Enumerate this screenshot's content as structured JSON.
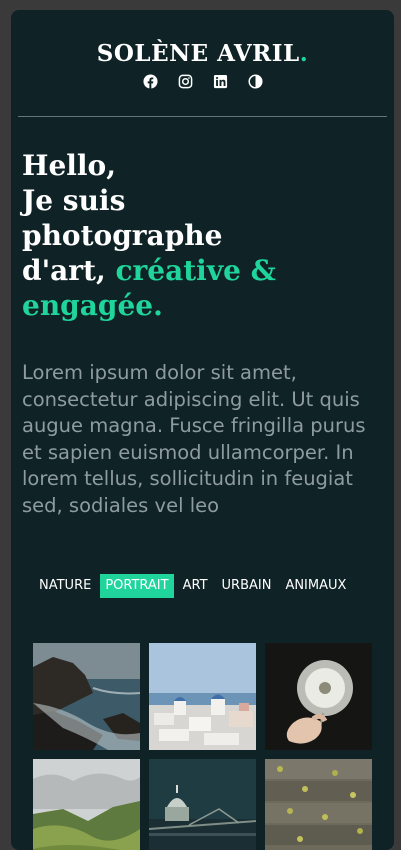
{
  "header": {
    "brand_name": "SOLÈNE AVRIL",
    "brand_dot": ".",
    "accent_color": "#1fd59b",
    "social_icons": [
      "facebook-icon",
      "instagram-icon",
      "linkedin-icon",
      "theme-toggle-icon"
    ]
  },
  "hero": {
    "line1": "Hello,",
    "line2": "Je suis",
    "line3": "photographe",
    "line4_plain": "d'art, ",
    "line4_highlight": "créative &",
    "line5_highlight": "engagée."
  },
  "intro": {
    "text": "Lorem ipsum dolor sit amet, consectetur adipiscing elit. Ut quis augue magna. Fusce fringilla purus et sapien euismod ullamcorper. In lorem tellus, sollicitudin in feugiat sed, sodiales vel leo"
  },
  "filters": {
    "items": [
      "NATURE",
      "PORTRAIT",
      "ART",
      "URBAIN",
      "ANIMAUX"
    ],
    "active": "PORTRAIT"
  },
  "gallery": {
    "photos": [
      "coastal-cliffs-photo",
      "santorini-village-photo",
      "dandelion-hand-photo",
      "green-hills-photo",
      "night-bridge-dome-photo",
      "wooden-deck-leaves-photo"
    ]
  }
}
